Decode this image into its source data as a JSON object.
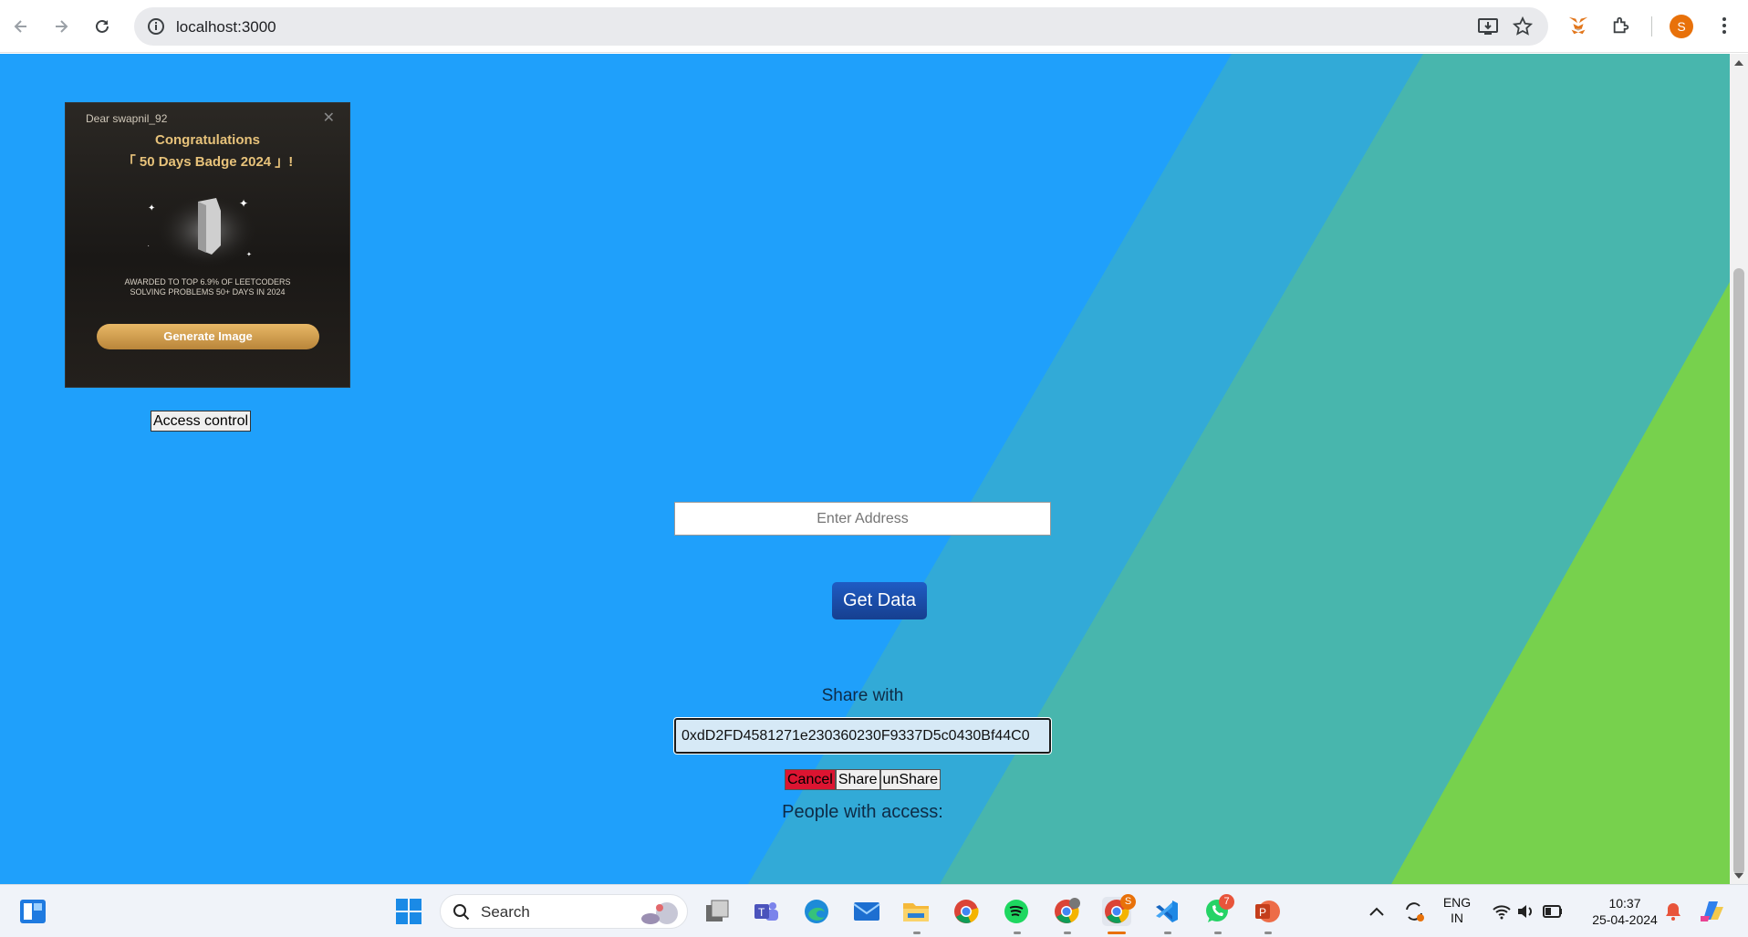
{
  "browser": {
    "url": "localhost:3000",
    "profile_initial": "S"
  },
  "badge": {
    "greeting": "Dear swapnil_92",
    "congrats": "Congratulations",
    "title": "「 50 Days Badge 2024 」!",
    "award_line1": "AWARDED TO TOP 6.9% OF LEETCODERS",
    "award_line2": "SOLVING PROBLEMS 50+ DAYS IN 2024",
    "button": "Generate Image"
  },
  "access_control_label": "Access control",
  "address_input": {
    "placeholder": "Enter Address",
    "value": ""
  },
  "get_data_label": "Get Data",
  "share": {
    "label": "Share with",
    "value": "0xdD2FD4581271e230360230F9337D5c0430Bf44C0",
    "cancel_label": "Cancel",
    "share_label": "Share",
    "unshare_label": "unShare"
  },
  "people_label": "People with access:",
  "taskbar": {
    "search_label": "Search",
    "language_line1": "ENG",
    "language_line2": "IN",
    "time": "10:37",
    "date": "25-04-2024",
    "whatsapp_badge": "7",
    "chrome_badge": "S"
  },
  "colors": {
    "page_bg": "#1fa0fb",
    "band_teal": "#3aaecb",
    "band_green": "#77d14d",
    "cancel_red": "#dc1431",
    "get_data_blue": "#1f5cc4"
  }
}
